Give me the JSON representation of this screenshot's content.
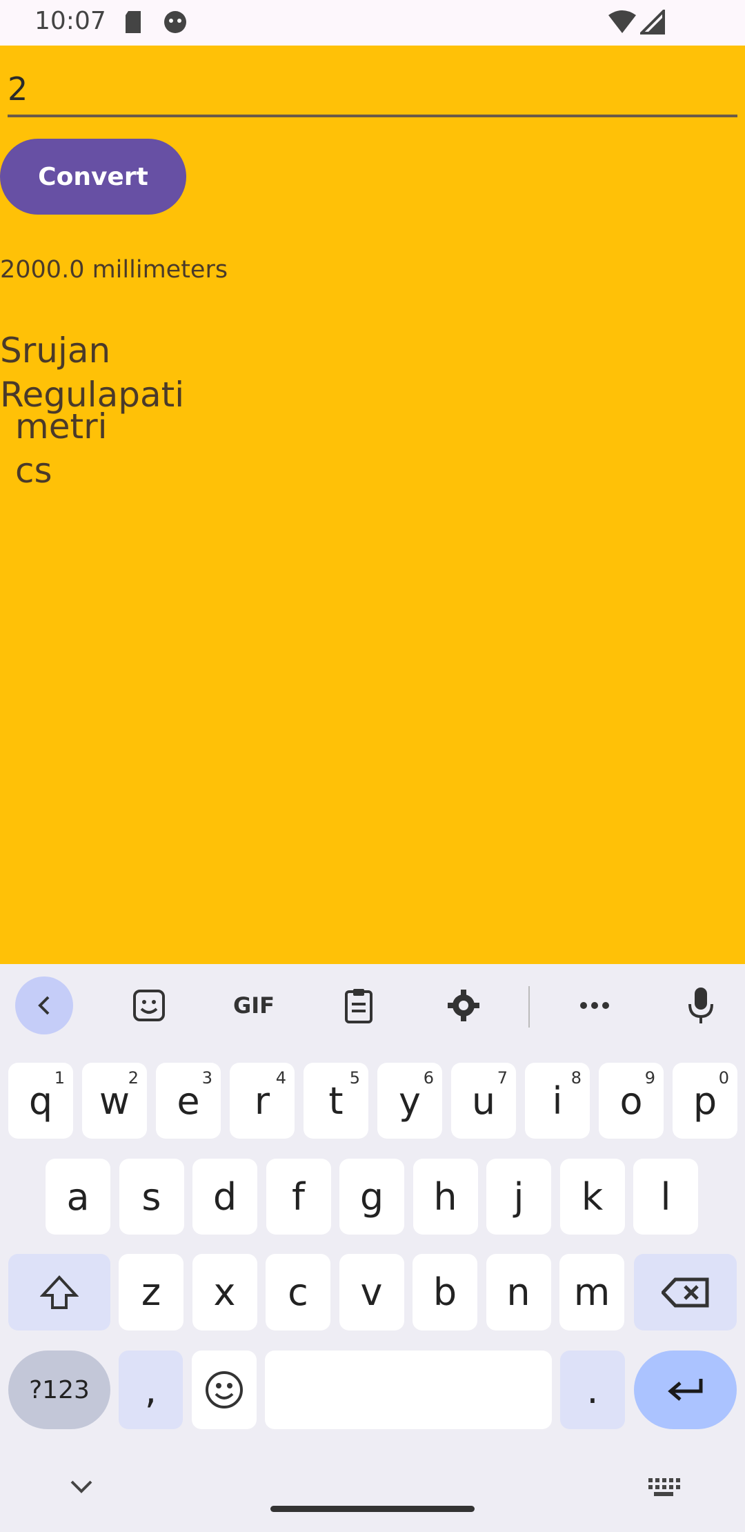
{
  "status_bar": {
    "time": "10:07"
  },
  "app": {
    "input_value": "2",
    "convert_label": "Convert",
    "result_text": "2000.0 millimeters",
    "author_line1": "Srujan",
    "author_line2": "Regulapati",
    "metrics_line1": "metri",
    "metrics_line2": "cs",
    "background_color": "#ffc107",
    "button_color": "#6750a4"
  },
  "keyboard": {
    "toolbar": {
      "back_icon": "chevron-left-icon",
      "sticker_icon": "sticker-icon",
      "gif_label": "GIF",
      "clipboard_icon": "clipboard-icon",
      "settings_icon": "gear-icon",
      "more_icon": "more-icon",
      "mic_icon": "mic-icon"
    },
    "row1": [
      {
        "k": "q",
        "n": "1"
      },
      {
        "k": "w",
        "n": "2"
      },
      {
        "k": "e",
        "n": "3"
      },
      {
        "k": "r",
        "n": "4"
      },
      {
        "k": "t",
        "n": "5"
      },
      {
        "k": "y",
        "n": "6"
      },
      {
        "k": "u",
        "n": "7"
      },
      {
        "k": "i",
        "n": "8"
      },
      {
        "k": "o",
        "n": "9"
      },
      {
        "k": "p",
        "n": "0"
      }
    ],
    "row2": [
      "a",
      "s",
      "d",
      "f",
      "g",
      "h",
      "j",
      "k",
      "l"
    ],
    "row3": [
      "z",
      "x",
      "c",
      "v",
      "b",
      "n",
      "m"
    ],
    "symbols_label": "?123",
    "comma_label": ",",
    "period_label": "."
  }
}
